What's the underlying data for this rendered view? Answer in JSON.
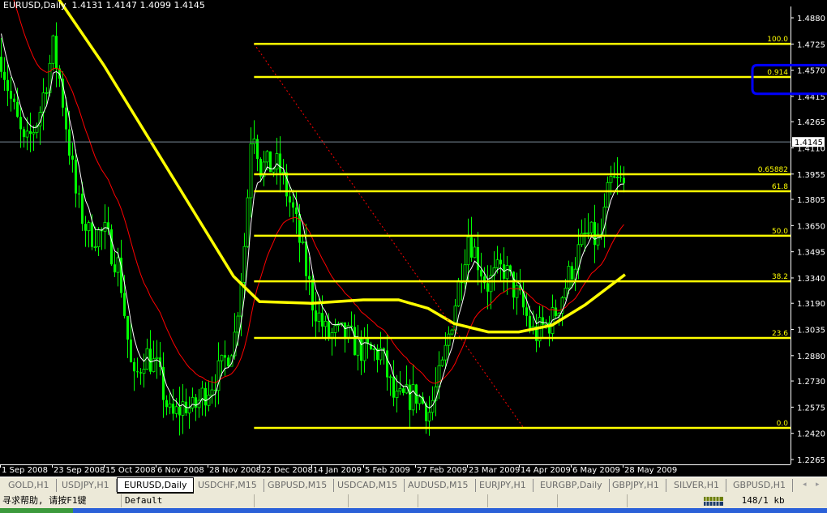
{
  "window": {
    "symbol_title": "EURUSD,Daily",
    "ohlc": "1.4131 1.4147 1.4099 1.4145"
  },
  "colors": {
    "background": "#000000",
    "bars": "#00ff00",
    "fib_levels": "#ffff00",
    "ma_slow": "#ffff00",
    "ma_mid": "#ff0000",
    "ma_fast": "#ffffff",
    "highlight_box": "#0000ff",
    "fib_trendline": "#ff0000"
  },
  "chart_data": {
    "type": "candlestick",
    "symbol": "EURUSD",
    "timeframe": "Daily",
    "ylim": [
      1.2265,
      1.488
    ],
    "y_ticks": [
      "1.4880",
      "1.4725",
      "1.4570",
      "1.4415",
      "1.4265",
      "1.4110",
      "1.3955",
      "1.3805",
      "1.3650",
      "1.3495",
      "1.3340",
      "1.3190",
      "1.3035",
      "1.2880",
      "1.2730",
      "1.2575",
      "1.2420",
      "1.2265"
    ],
    "x_ticks": [
      "1 Sep 2008",
      "23 Sep 2008",
      "15 Oct 2008",
      "6 Nov 2008",
      "28 Nov 2008",
      "22 Dec 2008",
      "14 Jan 2009",
      "5 Feb 2009",
      "27 Feb 2009",
      "23 Mar 2009",
      "14 Apr 2009",
      "6 May 2009",
      "28 May 2009"
    ],
    "x_tick_dates": [
      "2008-09-01",
      "2008-09-23",
      "2008-10-15",
      "2008-11-06",
      "2008-11-28",
      "2008-12-22",
      "2009-01-14",
      "2009-02-05",
      "2009-02-27",
      "2009-03-23",
      "2009-04-14",
      "2009-05-06",
      "2009-05-28"
    ],
    "current_price": "1.4145",
    "close_path": [
      [
        "2008-09-01",
        1.465
      ],
      [
        "2008-09-05",
        1.44
      ],
      [
        "2008-09-11",
        1.41
      ],
      [
        "2008-09-17",
        1.43
      ],
      [
        "2008-09-23",
        1.47
      ],
      [
        "2008-09-26",
        1.45
      ],
      [
        "2008-10-03",
        1.38
      ],
      [
        "2008-10-08",
        1.36
      ],
      [
        "2008-10-15",
        1.36
      ],
      [
        "2008-10-21",
        1.34
      ],
      [
        "2008-10-27",
        1.27
      ],
      [
        "2008-11-01",
        1.29
      ],
      [
        "2008-11-06",
        1.28
      ],
      [
        "2008-11-12",
        1.25
      ],
      [
        "2008-11-18",
        1.26
      ],
      [
        "2008-11-21",
        1.255
      ],
      [
        "2008-11-28",
        1.27
      ],
      [
        "2008-12-04",
        1.28
      ],
      [
        "2008-12-10",
        1.3
      ],
      [
        "2008-12-15",
        1.36
      ],
      [
        "2008-12-18",
        1.43
      ],
      [
        "2008-12-22",
        1.4
      ],
      [
        "2008-12-30",
        1.4
      ],
      [
        "2009-01-06",
        1.37
      ],
      [
        "2009-01-14",
        1.32
      ],
      [
        "2009-01-20",
        1.3
      ],
      [
        "2009-01-28",
        1.3
      ],
      [
        "2009-02-05",
        1.29
      ],
      [
        "2009-02-12",
        1.29
      ],
      [
        "2009-02-18",
        1.26
      ],
      [
        "2009-02-27",
        1.265
      ],
      [
        "2009-03-05",
        1.255
      ],
      [
        "2009-03-11",
        1.28
      ],
      [
        "2009-03-17",
        1.32
      ],
      [
        "2009-03-23",
        1.36
      ],
      [
        "2009-03-31",
        1.33
      ],
      [
        "2009-04-07",
        1.34
      ],
      [
        "2009-04-14",
        1.32
      ],
      [
        "2009-04-20",
        1.3
      ],
      [
        "2009-04-28",
        1.31
      ],
      [
        "2009-05-06",
        1.34
      ],
      [
        "2009-05-12",
        1.36
      ],
      [
        "2009-05-18",
        1.355
      ],
      [
        "2009-05-22",
        1.39
      ],
      [
        "2009-05-28",
        1.39
      ],
      [
        "2009-05-29",
        1.4145
      ]
    ],
    "ma_slow_path": [
      [
        "2008-09-01",
        1.535
      ],
      [
        "2008-09-23",
        1.505
      ],
      [
        "2008-10-15",
        1.46
      ],
      [
        "2008-11-06",
        1.41
      ],
      [
        "2008-11-28",
        1.36
      ],
      [
        "2008-12-10",
        1.335
      ],
      [
        "2008-12-22",
        1.32
      ],
      [
        "2009-01-14",
        1.319
      ],
      [
        "2009-02-05",
        1.321
      ],
      [
        "2009-02-20",
        1.321
      ],
      [
        "2009-03-05",
        1.316
      ],
      [
        "2009-03-17",
        1.307
      ],
      [
        "2009-04-01",
        1.302
      ],
      [
        "2009-04-14",
        1.302
      ],
      [
        "2009-04-28",
        1.306
      ],
      [
        "2009-05-12",
        1.318
      ],
      [
        "2009-05-29",
        1.336
      ]
    ],
    "fibonacci": {
      "start_date": "2008-12-18",
      "end_date": "2009-04-16",
      "levels": [
        {
          "label": "100.0",
          "price": 1.4726
        },
        {
          "label": "0.914",
          "price": 1.453
        },
        {
          "label": "0.65882",
          "price": 1.3954
        },
        {
          "label": "61.8",
          "price": 1.3853
        },
        {
          "label": "50.0",
          "price": 1.359
        },
        {
          "label": "38.2",
          "price": 1.332
        },
        {
          "label": "23.6",
          "price": 1.2985
        },
        {
          "label": "0.0",
          "price": 1.2452
        }
      ]
    },
    "highlight_box": {
      "price_top": 1.46,
      "price_bottom": 1.443
    }
  },
  "tabs": [
    {
      "label": "GOLD,H1",
      "active": false
    },
    {
      "label": "USDJPY,H1",
      "active": false
    },
    {
      "label": "EURUSD,Daily",
      "active": true
    },
    {
      "label": "USDCHF,M15",
      "active": false
    },
    {
      "label": "GBPUSD,M15",
      "active": false
    },
    {
      "label": "USDCAD,M15",
      "active": false
    },
    {
      "label": "AUDUSD,M15",
      "active": false
    },
    {
      "label": "EURJPY,H1",
      "active": false
    },
    {
      "label": "EURGBP,Daily",
      "active": false
    },
    {
      "label": "GBPJPY,H1",
      "active": false
    },
    {
      "label": "SILVER,H1",
      "active": false
    },
    {
      "label": "GBPUSD,H1",
      "active": false
    }
  ],
  "tab_scroll": {
    "left": "◂",
    "right": "▸"
  },
  "status": {
    "help": "寻求帮助, 请按F1键",
    "profile": "Default",
    "traffic": "148/1 kb"
  }
}
